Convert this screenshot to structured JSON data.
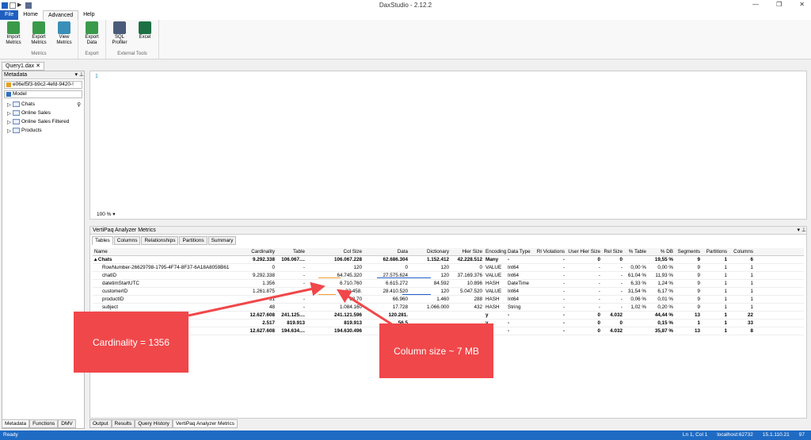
{
  "window": {
    "title": "DaxStudio - 2.12.2",
    "controls": [
      "—",
      "❐",
      "✕"
    ]
  },
  "ribbon_tabs": [
    "File",
    "Home",
    "Advanced",
    "Help"
  ],
  "ribbon": {
    "groups": [
      {
        "label": "Metrics",
        "buttons": [
          "Import Metrics",
          "Export Metrics",
          "View Metrics"
        ]
      },
      {
        "label": "Export",
        "buttons": [
          "Export Data"
        ]
      },
      {
        "label": "External Tools",
        "buttons": [
          "SQL Profiler",
          "Excel"
        ]
      }
    ]
  },
  "doc_tab": "Query1.dax",
  "doc_close": "✕",
  "metadata": {
    "header": "Metadata",
    "pin": "▾ ⊥",
    "connection": "e06ef5f3-b9c2-4efd-9420-!",
    "model": "Model",
    "tables": [
      "Chats",
      "Online Sales",
      "Online Sales Filtered",
      "Products"
    ]
  },
  "left_bottom_tabs": [
    "Metadata",
    "Functions",
    "DMV"
  ],
  "editor": {
    "line_no": "1",
    "zoom": "100 %"
  },
  "vpm": {
    "header": "VertiPaq Analyzer Metrics",
    "pin": "▾ ⊥",
    "tabs": [
      "Tables",
      "Columns",
      "Relationships",
      "Partitions",
      "Summary"
    ],
    "columns": [
      "Name",
      "Cardinality",
      "Table",
      "Col Size",
      "Data",
      "Dictionary",
      "Hier Size",
      "Encoding",
      "Data Type",
      "RI Violations",
      "User Hier Size",
      "Rel Size",
      "% Table",
      "% DB",
      "Segments",
      "Partitions",
      "Columns"
    ],
    "rows": [
      {
        "bold": true,
        "cells": [
          "▴ Chats",
          "9.292.338",
          "106.067....",
          "106.067.228",
          "62.686.304",
          "1.152.412",
          "42.228.512",
          "Many",
          "-",
          "-",
          "0",
          "0",
          "",
          "19,55 %",
          "9",
          "1",
          "6"
        ]
      },
      {
        "bold": false,
        "cells": [
          "RowNumber-26629798-1795-4F74-8F37-6A18A8059B61",
          "0",
          "-",
          "120",
          "0",
          "120",
          "0",
          "VALUE",
          "Int64",
          "-",
          "-",
          "-",
          "0,00 %",
          "0,00 %",
          "9",
          "1",
          "1"
        ]
      },
      {
        "bold": false,
        "cells": [
          "chatID",
          "9.292.338",
          "-",
          "64.745.320",
          "27.575.624",
          "120",
          "37.169.376",
          "VALUE",
          "Int64",
          "-",
          "-",
          "-",
          "61,04 %",
          "11,93 %",
          "9",
          "1",
          "1"
        ]
      },
      {
        "bold": false,
        "cells": [
          "datetimStartUTC",
          "1.356",
          "-",
          "6.710.760",
          "6.615.272",
          "84.592",
          "10.896",
          "HASH",
          "DateTime",
          "-",
          "-",
          "-",
          "6,33 %",
          "1,24 %",
          "9",
          "1",
          "1"
        ]
      },
      {
        "bold": false,
        "cells": [
          "customerID",
          "1.261.875",
          "-",
          "33.458.",
          "28.410.520",
          "120",
          "5.047.520",
          "VALUE",
          "Int64",
          "-",
          "-",
          "-",
          "31,54 %",
          "6,17 %",
          "9",
          "1",
          "1"
        ]
      },
      {
        "bold": false,
        "cells": [
          "productID",
          "31",
          "-",
          "68.70",
          "66.960",
          "1.460",
          "288",
          "HASH",
          "Int64",
          "-",
          "-",
          "-",
          "0,06 %",
          "0,01 %",
          "9",
          "1",
          "1"
        ]
      },
      {
        "bold": false,
        "cells": [
          "subject",
          "48",
          "-",
          "1.084.160",
          "17.728",
          "1.066.000",
          "432",
          "HASH",
          "String",
          "-",
          "-",
          "-",
          "1,02 %",
          "0,20 %",
          "9",
          "1",
          "1"
        ]
      },
      {
        "bold": true,
        "cells": [
          "",
          "12.627.608",
          "241.125....",
          "241.121.596",
          "120.281.",
          "",
          "",
          "y",
          "-",
          "-",
          "0",
          "4.032",
          "",
          "44,44 %",
          "13",
          "1",
          "22"
        ]
      },
      {
        "bold": true,
        "cells": [
          "",
          "2.517",
          "819.913",
          "819.913",
          "56.5",
          "",
          "",
          "y",
          "-",
          "-",
          "0",
          "0",
          "",
          "0,15 %",
          "1",
          "1",
          "33"
        ]
      },
      {
        "bold": true,
        "cells": [
          "",
          "12.627.608",
          "194.634....",
          "194.630.496",
          "73.513.9",
          "",
          "",
          "y",
          "-",
          "-",
          "0",
          "4.032",
          "",
          "35,87 %",
          "13",
          "1",
          "8"
        ]
      }
    ]
  },
  "output_tabs": [
    "Output",
    "Results",
    "Query History",
    "VertiPaq Analyzer Metrics"
  ],
  "status": {
    "left": "Ready",
    "position": "Ln 1, Col 1",
    "server": "localhost:62732",
    "version": "15.1.110.21",
    "spid": "97"
  },
  "callouts": {
    "cardinality": "Cardinality = 1356",
    "colsize": "Column size ~ 7 MB"
  },
  "colors": {
    "accent": "#1f6bc4",
    "callout": "#f0474a",
    "arrow": "#f0474a",
    "underline_orange": "#f0a030",
    "underline_blue": "#2060d0"
  }
}
